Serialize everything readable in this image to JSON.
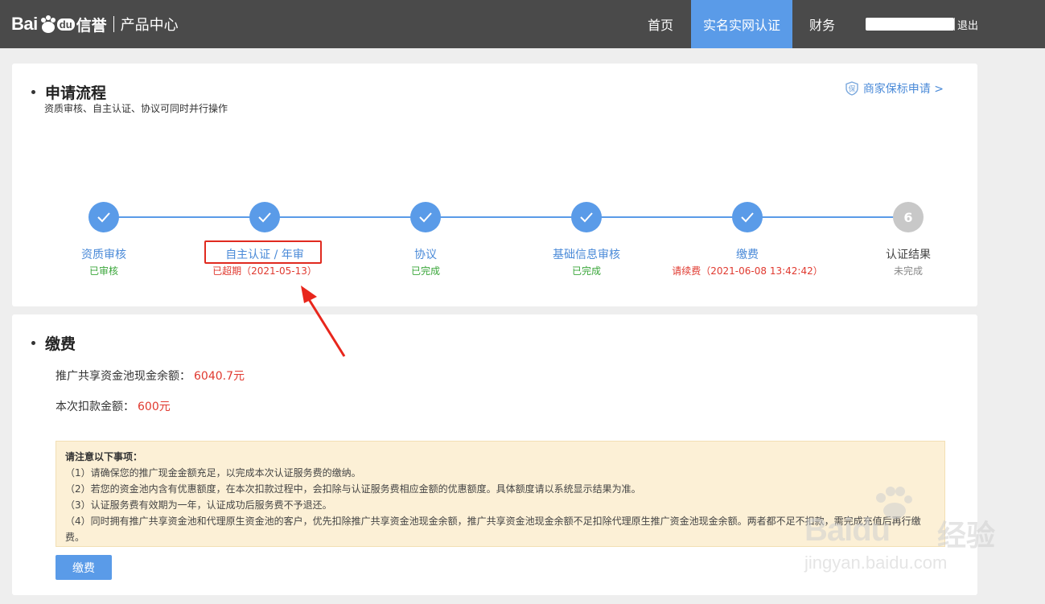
{
  "header": {
    "logo_bai": "Bai",
    "logo_du": "du",
    "logo_xin": "信誉",
    "product_center": "产品中心",
    "nav": [
      "首页",
      "实名实网认证",
      "财务"
    ],
    "logout": "退出"
  },
  "process": {
    "title": "申请流程",
    "subtitle": "资质审核、自主认证、协议可同时并行操作",
    "guarantee_link": "商家保标申请 >",
    "steps": [
      {
        "name": "资质审核",
        "status": "已审核",
        "state": "done"
      },
      {
        "name": "自主认证 / 年审",
        "status": "已超期（2021-05-13）",
        "state": "done"
      },
      {
        "name": "协议",
        "status": "已完成",
        "state": "done"
      },
      {
        "name": "基础信息审核",
        "status": "已完成",
        "state": "done"
      },
      {
        "name": "缴费",
        "status": "请续费（2021-06-08 13:42:42）",
        "state": "done"
      },
      {
        "name": "认证结果",
        "status": "未完成",
        "state": "todo",
        "number": "6"
      }
    ]
  },
  "payment": {
    "title": "缴费",
    "balance_label": "推广共享资金池现金余额：",
    "balance_value": "6040.7元",
    "deduct_label": "本次扣款金额：",
    "deduct_value": "600元",
    "notice_title": "请注意以下事项：",
    "notice_items": [
      "（1）请确保您的推广现金金额充足，以完成本次认证服务费的缴纳。",
      "（2）若您的资金池内含有优惠额度，在本次扣款过程中，会扣除与认证服务费相应金额的优惠额度。具体额度请以系统显示结果为准。",
      "（3）认证服务费有效期为一年，认证成功后服务费不予退还。",
      "（4）同时拥有推广共享资金池和代理原生资金池的客户，优先扣除推广共享资金池现金余额，推广共享资金池现金余额不足扣除代理原生推广资金池现金余额。两者都不足不扣款，需完成充值后再行缴费。"
    ],
    "button": "缴费"
  },
  "watermark": {
    "brand": "Baidu",
    "suffix": "经验",
    "url": "jingyan.baidu.com"
  },
  "colors": {
    "accent": "#5a9be8",
    "header_bg": "#4a4a4a",
    "green": "#3aa63a",
    "red": "#e0392f",
    "notice_bg": "#fcf0d6"
  }
}
